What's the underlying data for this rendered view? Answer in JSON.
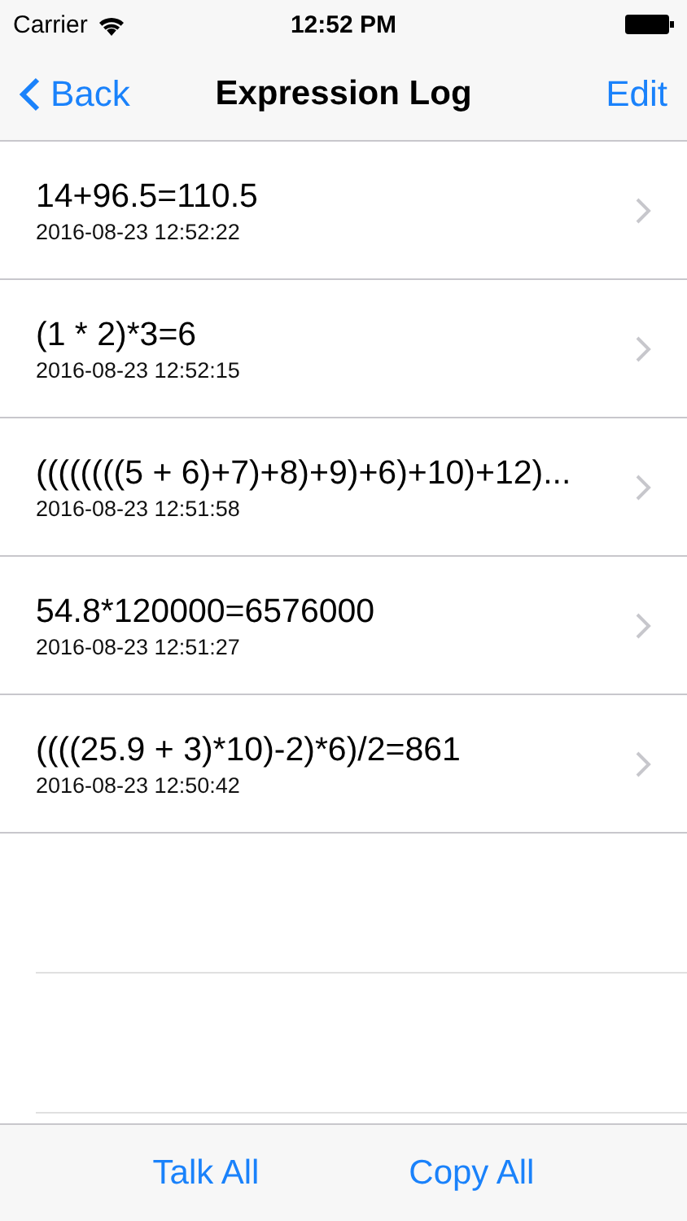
{
  "status_bar": {
    "carrier": "Carrier",
    "time": "12:52 PM"
  },
  "nav_bar": {
    "back": "Back",
    "title": "Expression Log",
    "action": "Edit"
  },
  "entries": [
    {
      "expression": "14+96.5=110.5",
      "timestamp": "2016-08-23 12:52:22"
    },
    {
      "expression": "(1 * 2)*3=6",
      "timestamp": "2016-08-23 12:52:15"
    },
    {
      "expression": "((((((((5 + 6)+7)+8)+9)+6)+10)+12)...",
      "timestamp": "2016-08-23 12:51:58"
    },
    {
      "expression": "54.8*120000=6576000",
      "timestamp": "2016-08-23 12:51:27"
    },
    {
      "expression": "((((25.9 + 3)*10)-2)*6)/2=861",
      "timestamp": "2016-08-23 12:50:42"
    }
  ],
  "toolbar": [
    "Talk All",
    "Copy All"
  ]
}
